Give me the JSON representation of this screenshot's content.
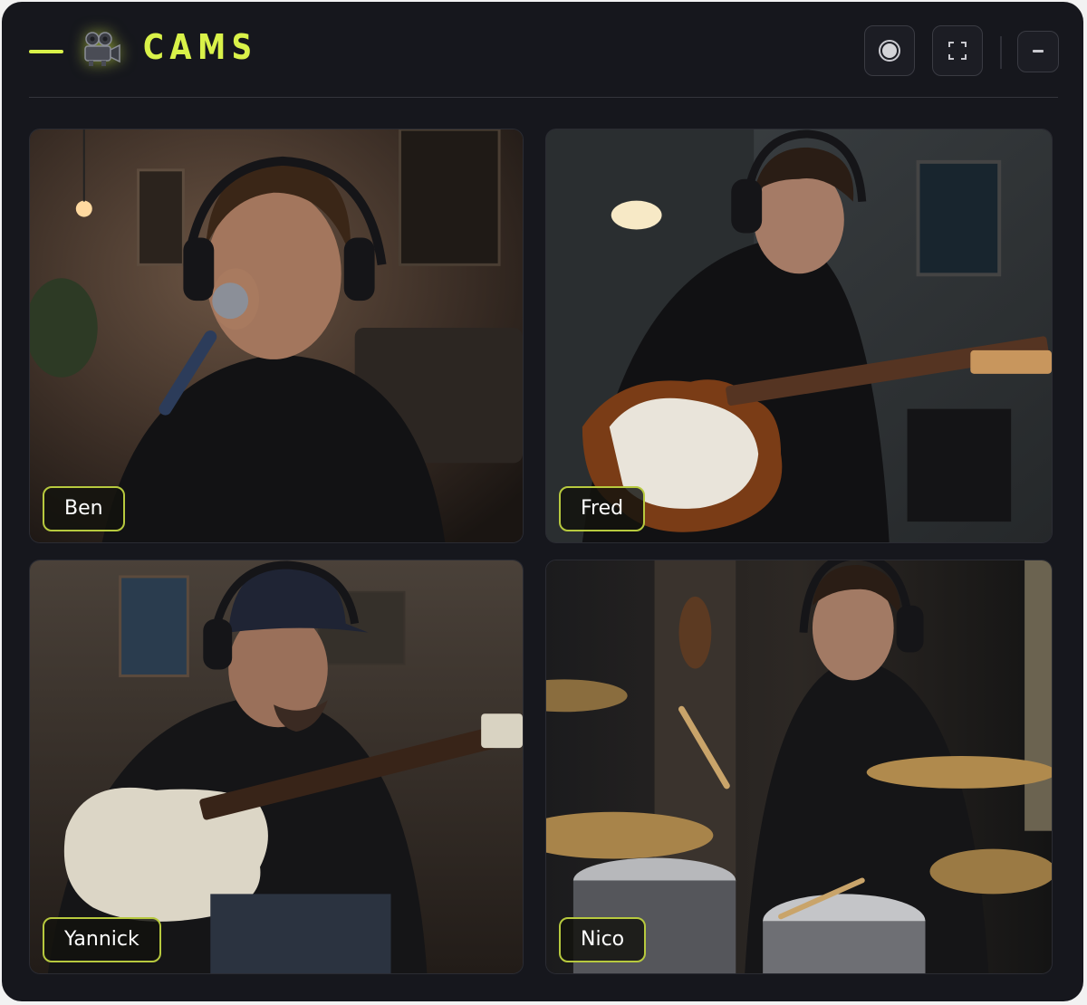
{
  "header": {
    "title": "CAMS",
    "icon": "movie-camera-icon",
    "accent_color": "#d9f249",
    "buttons": [
      {
        "name": "record",
        "icon": "record-icon"
      },
      {
        "name": "fullscreen",
        "icon": "fullscreen-icon"
      },
      {
        "name": "minimize",
        "icon": "minimize-icon"
      }
    ]
  },
  "cams": [
    {
      "name": "Ben",
      "role_visual": "vocals-microphone"
    },
    {
      "name": "Fred",
      "role_visual": "electric-guitar"
    },
    {
      "name": "Yannick",
      "role_visual": "bass-guitar"
    },
    {
      "name": "Nico",
      "role_visual": "drums"
    }
  ]
}
